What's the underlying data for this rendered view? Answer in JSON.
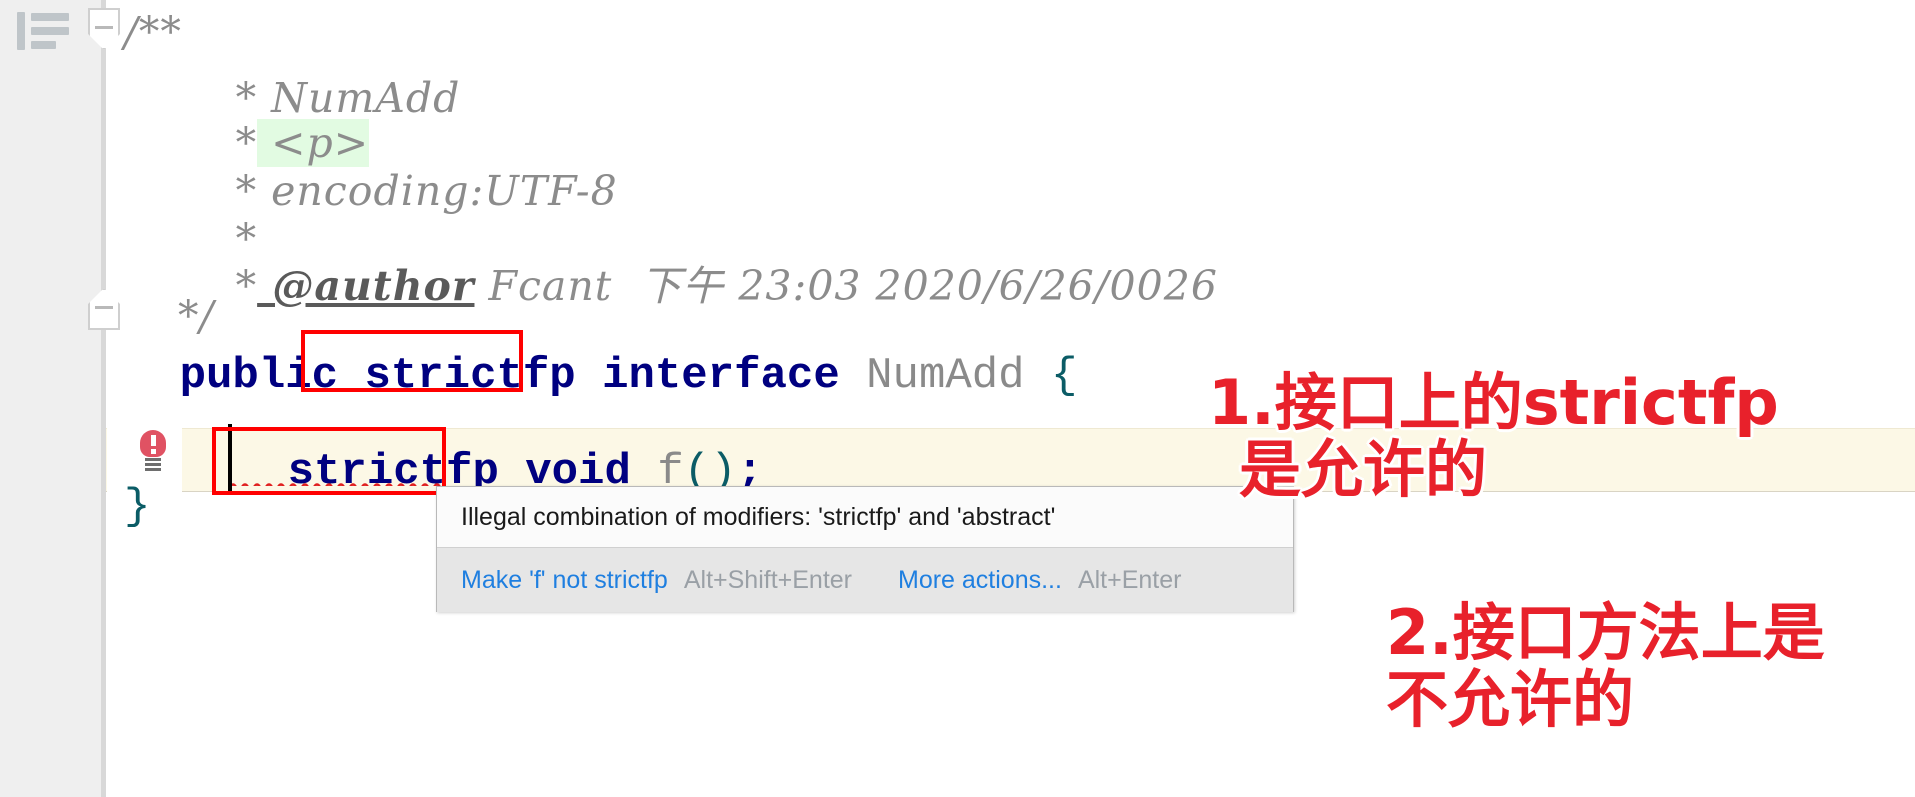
{
  "editor": {
    "app": "IntelliJ IDEA Java editor",
    "file_language": "Java",
    "gutter": {
      "align_icon": "align-left-icon",
      "fold_top": "fold-collapse-marker",
      "fold_bottom": "fold-collapse-marker",
      "error_bulb": "error-bulb-icon"
    },
    "javadoc": {
      "open": "/**",
      "lines": [
        {
          "star": "*",
          "text": " NumAdd"
        },
        {
          "star": "*",
          "text": " <p>",
          "highlight": true
        },
        {
          "star": "*",
          "text": " encoding:UTF-8"
        },
        {
          "star": "*",
          "text": ""
        },
        {
          "star": "*",
          "tag": " @author",
          "text": " Fcant  下午 23:03 2020/6/26/0026"
        }
      ],
      "close": "*/"
    },
    "code": {
      "declaration": {
        "modifier_public": "public",
        "modifier_strictfp": "strictfp",
        "keyword_interface": "interface",
        "type_name": "NumAdd",
        "open_brace": "{"
      },
      "method": {
        "modifier_strictfp": "strictfp",
        "return_type": "void",
        "name": "f",
        "params": "()",
        "semicolon": ";"
      },
      "close_brace": "}"
    }
  },
  "popup": {
    "message": "Illegal combination of modifiers: 'strictfp' and 'abstract'",
    "actions": [
      {
        "label": "Make 'f' not strictfp",
        "shortcut": "Alt+Shift+Enter"
      },
      {
        "label": "More actions...",
        "shortcut": "Alt+Enter"
      }
    ]
  },
  "annotations": [
    {
      "id": 1,
      "text": "1.接口上的strictfp\n是允许的"
    },
    {
      "id": 2,
      "text": "2.接口方法上是\n不允许的"
    }
  ],
  "colors": {
    "keyword": "#000080",
    "identifier": "#8a8a8a",
    "comment": "#8c8c8c",
    "brace": "#0b5c66",
    "annotation_red": "#e8212b",
    "box_red": "#ff0000",
    "caret_line_bg": "#fcf8e6",
    "tag_highlight_bg": "#e2fbe2",
    "gutter_bg": "#efefef",
    "link_blue": "#1f7fe0",
    "shortcut_gray": "#9aa0a6",
    "bulb_red": "#e05263"
  }
}
